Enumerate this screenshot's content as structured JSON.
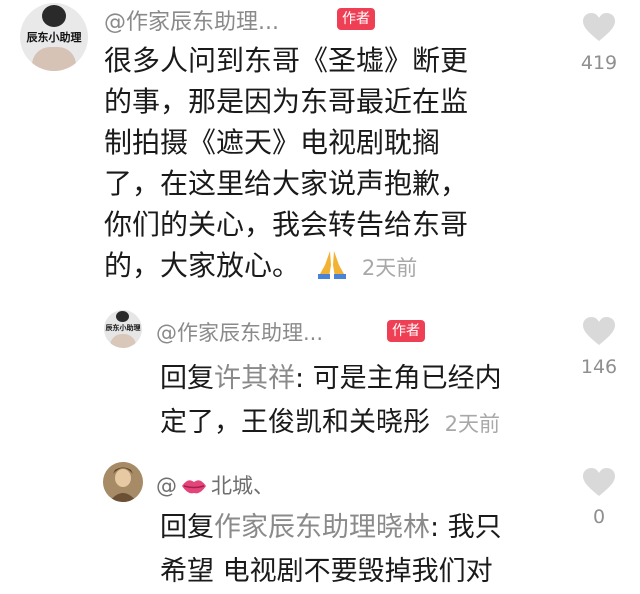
{
  "comment1": {
    "avatar_caption": "辰东小助理",
    "username": "@作家辰东助理...",
    "badge": "作者",
    "lines": [
      "很多人问到东哥《圣墟》断更",
      "的事，那是因为东哥最近在监",
      "制拍摄《遮天》电视剧耽搁",
      "了，在这里给大家说声抱歉，",
      "你们的关心，我会转告给东哥",
      "的，大家放心。"
    ],
    "emoji": "folded-hands",
    "time": "2天前",
    "likes": "419"
  },
  "reply1": {
    "avatar_caption": "辰东小助理",
    "username": "@作家辰东助理...",
    "badge": "作者",
    "reply_prefix": "回复",
    "mention": "许其祥",
    "line1_rest": ": 可是主角已经内",
    "line2": "定了，王俊凯和关晓彤",
    "time": "2天前",
    "likes": "146"
  },
  "reply2": {
    "username_prefix": "@",
    "username_suffix": "北城、",
    "reply_prefix": "回复",
    "mention": "作家辰东助理晓林",
    "line1_rest": ": 我只",
    "line2": "希望 电视剧不要毁掉我们对",
    "likes": "0"
  },
  "colors": {
    "badge": "#ef3f55",
    "username": "#8a8a8a",
    "text": "#1a1a1a",
    "heart": "#d9d9d9"
  }
}
